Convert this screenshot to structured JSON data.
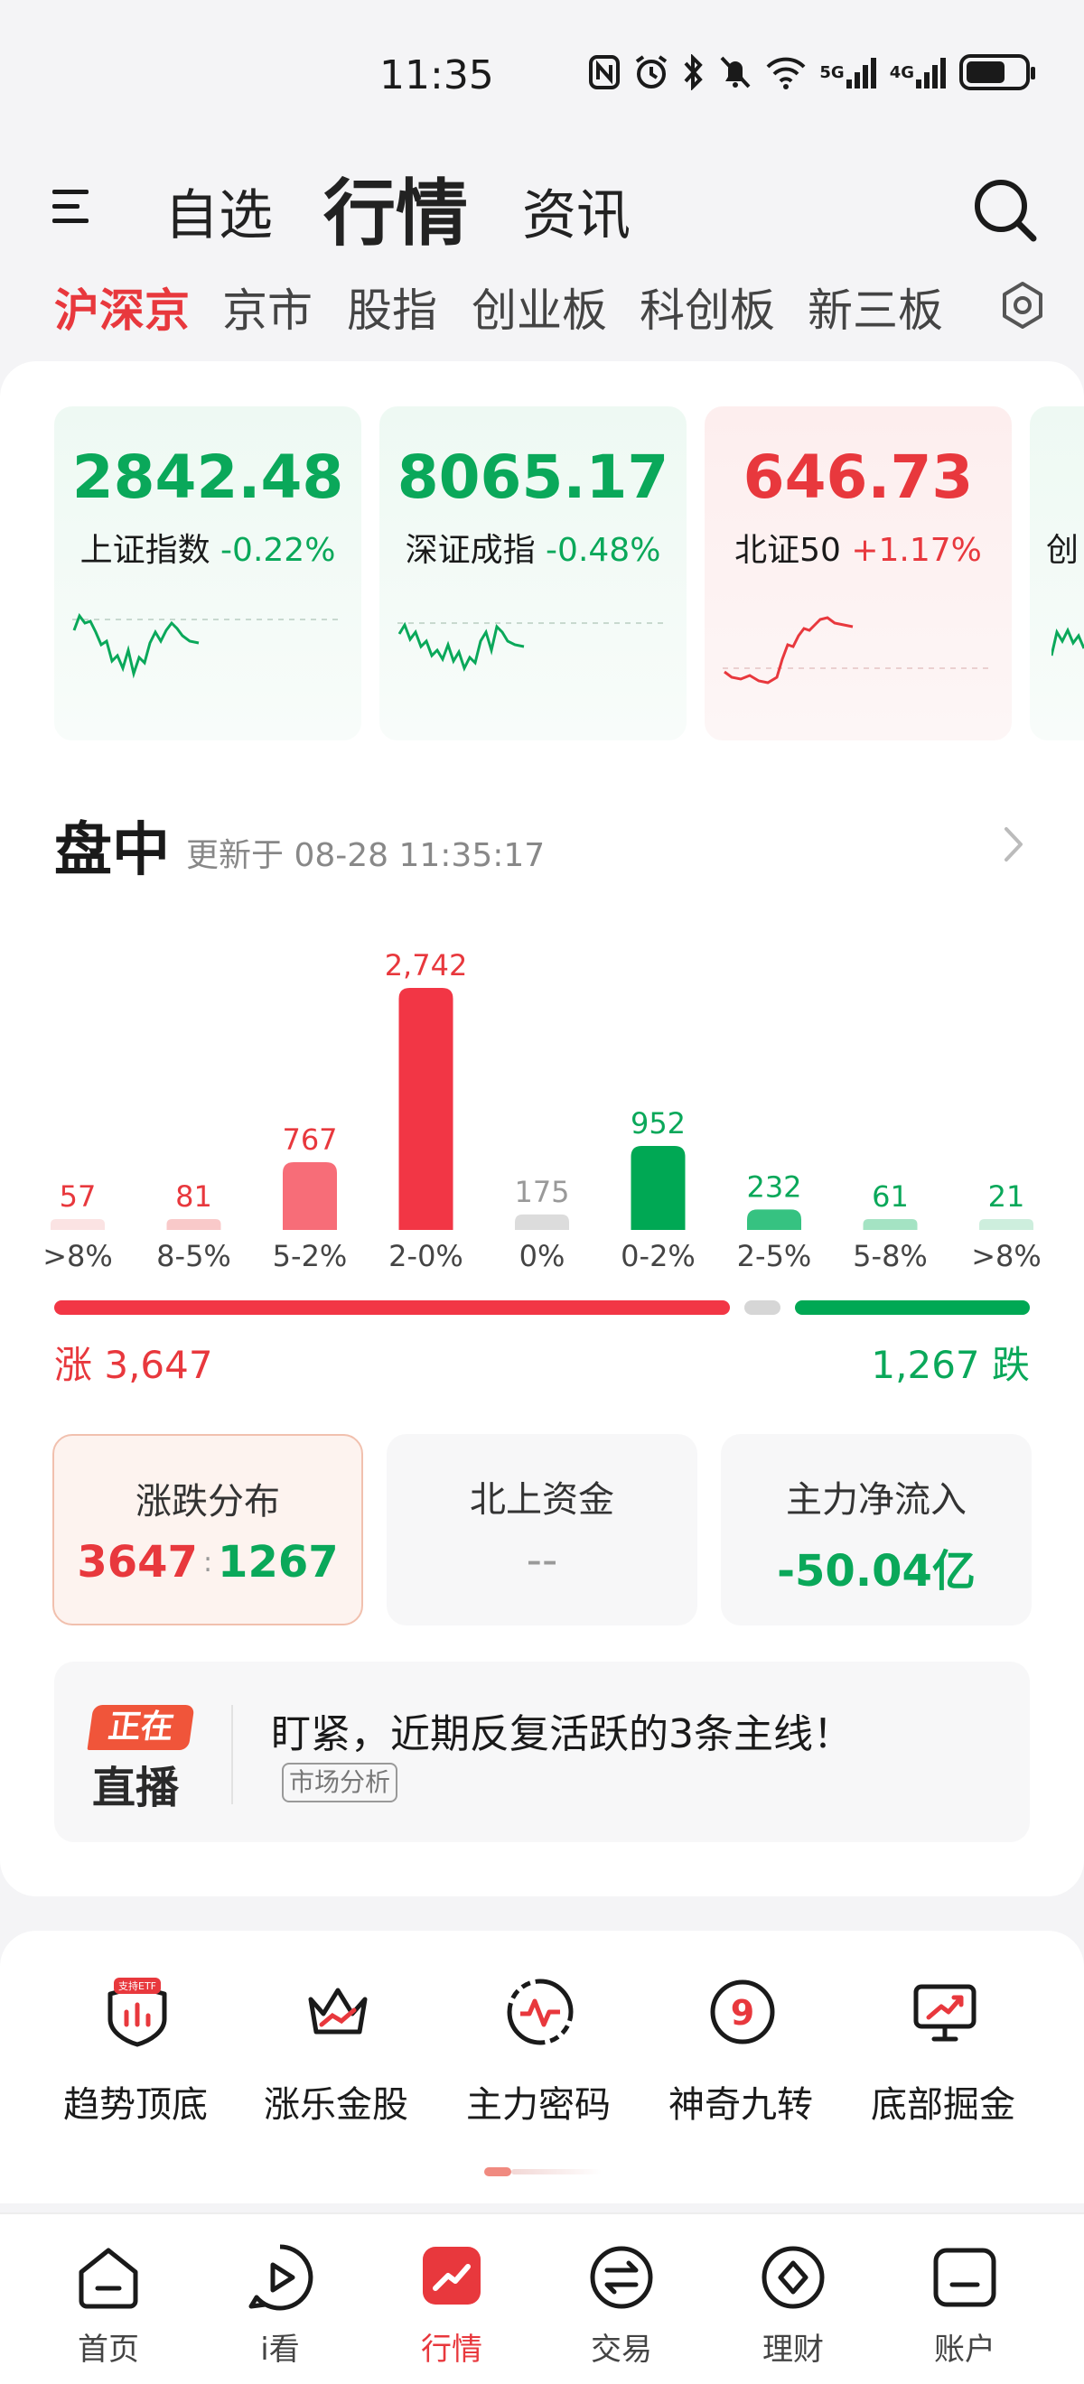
{
  "status_bar": {
    "time": "11:35",
    "net1": "5G",
    "net2": "4G"
  },
  "top_nav": {
    "tabs": [
      "自选",
      "行情",
      "资讯"
    ],
    "active_index": 1
  },
  "sub_tabs": {
    "tabs": [
      "沪深京",
      "京市",
      "股指",
      "创业板",
      "科创板",
      "新三板"
    ],
    "active_index": 0
  },
  "indices": [
    {
      "value": "2842.48",
      "name": "上证指数",
      "change": "-0.22%",
      "trend": "down"
    },
    {
      "value": "8065.17",
      "name": "深证成指",
      "change": "-0.48%",
      "trend": "down"
    },
    {
      "value": "646.73",
      "name": "北证50",
      "change": "+1.17%",
      "trend": "up"
    },
    {
      "value": "",
      "name": "创",
      "change": "",
      "trend": "down"
    }
  ],
  "intraday": {
    "title": "盘中",
    "updated": "更新于 08-28 11:35:17"
  },
  "chart_data": {
    "type": "bar",
    "categories": [
      ">8%",
      "8-5%",
      "5-2%",
      "2-0%",
      "0%",
      "0-2%",
      "2-5%",
      "5-8%",
      ">8%"
    ],
    "values": [
      57,
      81,
      767,
      2742,
      175,
      952,
      232,
      61,
      21
    ],
    "value_labels": [
      "57",
      "81",
      "767",
      "2,742",
      "175",
      "952",
      "232",
      "61",
      "21"
    ],
    "colors": [
      "#fbe3e3",
      "#f9c9c9",
      "#f76d78",
      "#f23645",
      "#dcdcdc",
      "#00a854",
      "#36c281",
      "#a4e3c3",
      "#cdeedd"
    ],
    "label_colors": [
      "#e8383d",
      "#e8383d",
      "#e8383d",
      "#e8383d",
      "#999999",
      "#0aa85a",
      "#0aa85a",
      "#0aa85a",
      "#0aa85a"
    ]
  },
  "totals": {
    "rise": 3647,
    "flat": 175,
    "fall": 1267,
    "rise_label": "涨 3,647",
    "fall_label": "1,267 跌"
  },
  "stat_cards": [
    {
      "label": "涨跌分布",
      "value_up": "3647",
      "sep": ":",
      "value_down": "1267"
    },
    {
      "label": "北上资金",
      "value": "--"
    },
    {
      "label": "主力净流入",
      "value": "-50.04亿"
    }
  ],
  "live": {
    "badge_top": "正在",
    "badge_bottom": "直播",
    "title": "盯紧，近期反复活跃的3条主线！",
    "tag": "市场分析"
  },
  "tools": [
    {
      "label": "趋势顶底",
      "badge": "支持ETF"
    },
    {
      "label": "涨乐金股"
    },
    {
      "label": "主力密码"
    },
    {
      "label": "神奇九转",
      "icon_text": "9"
    },
    {
      "label": "底部掘金"
    }
  ],
  "bottom_nav": {
    "items": [
      "首页",
      "i看",
      "行情",
      "交易",
      "理财",
      "账户"
    ],
    "active_index": 2
  },
  "colors": {
    "red": "#e8383d",
    "green": "#0aa85a"
  }
}
